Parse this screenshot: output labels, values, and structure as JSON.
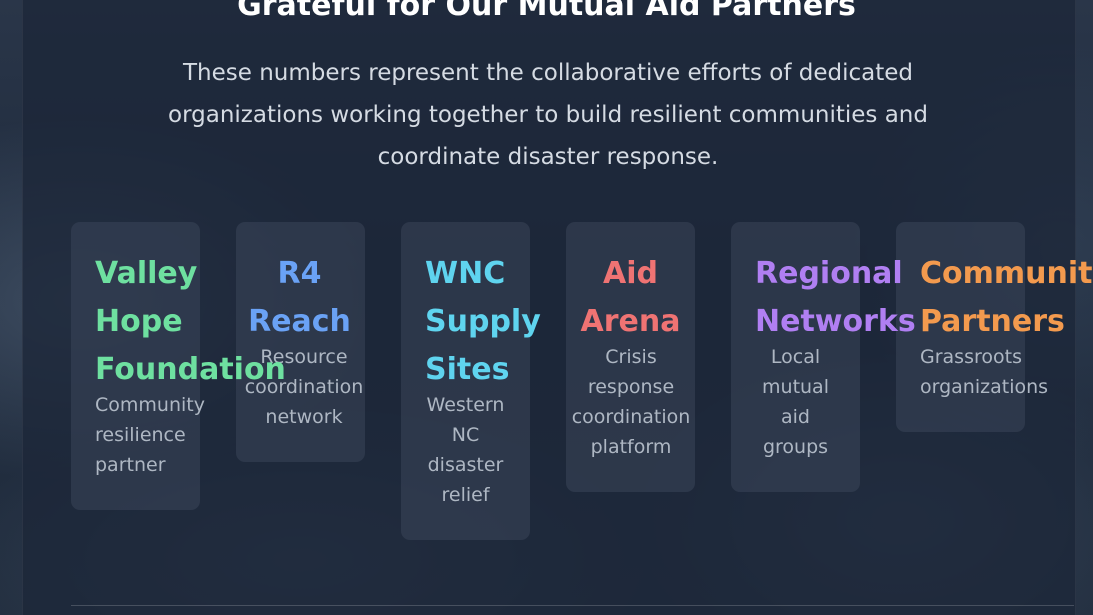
{
  "header": {
    "title": "Grateful for Our Mutual Aid Partners",
    "subtitle": "These numbers represent the collaborative efforts of dedicated organizations working together to build resilient communities and coordinate disaster response."
  },
  "partners": [
    {
      "name": "Valley\nHope\nFoundation",
      "description": "Community\nresilience\npartner",
      "color": "#6ee0a0"
    },
    {
      "name": "R4\nReach",
      "description": "Resource\ncoordination\nnetwork",
      "color": "#6aa2f5"
    },
    {
      "name": "WNC\nSupply\nSites",
      "description": "Western\nNC\ndisaster\nrelief",
      "color": "#5fd4ef"
    },
    {
      "name": "Aid\nArena",
      "description": "Crisis\nresponse\ncoordination\nplatform",
      "color": "#ef7373"
    },
    {
      "name": "Regional\nNetworks",
      "description": "Local\nmutual\naid\ngroups",
      "color": "#b07ff2"
    },
    {
      "name": "Community\nPartners",
      "description": "Grassroots\norganizations",
      "color": "#f39a4e"
    }
  ]
}
